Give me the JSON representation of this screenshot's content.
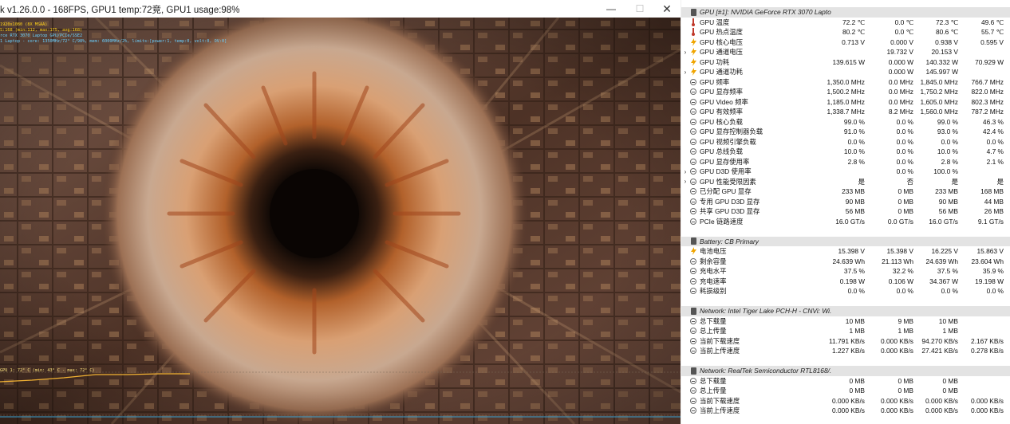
{
  "furmark": {
    "title": "k v1.26.0.0 - 168FPS, GPU1 temp:72竞, GPU1 usage:98%",
    "osd": [
      "1920x1080 (8X MSAA)",
      "S:168 (min:112, max:175, avg:168)",
      "rce RTX 3070 Laptop GPU/PCIe/SSE2",
      "1 Laptop - core: 1350MHz/72° C/98%, mem: 6000MHz/2%, limits:[power:1, temp:0, volt:0, OV:0]"
    ],
    "graph_label": "GPU 1: 72° C (min: 43° C - max: 72° C)",
    "controls": {
      "minimize": "—",
      "maximize": "☐",
      "close": "✕"
    },
    "colors": {
      "osd_yellow": "#ffd21a",
      "osd_blue": "#6ad0ff",
      "temp_line": "#f2b233"
    }
  },
  "hwinfo": {
    "rows": [
      {
        "type": "header",
        "label": "GPU [#1]: NVIDIA GeForce RTX 3070 Lapto..."
      },
      {
        "icon": "thermometer-icon",
        "label": "GPU 温度",
        "v": [
          "72.2 ℃",
          "0.0 ℃",
          "72.3 ℃",
          "49.6 ℃"
        ]
      },
      {
        "icon": "thermometer-icon",
        "label": "GPU 热点温度",
        "v": [
          "80.2 ℃",
          "0.0 ℃",
          "80.6 ℃",
          "55.7 ℃"
        ]
      },
      {
        "icon": "voltage-icon",
        "label": "GPU 核心电压",
        "v": [
          "0.713 V",
          "0.000 V",
          "0.938 V",
          "0.595 V"
        ]
      },
      {
        "icon": "voltage-icon",
        "expand": true,
        "label": "GPU 通道电压",
        "v": [
          "",
          "19.732 V",
          "20.153 V",
          ""
        ]
      },
      {
        "icon": "voltage-icon",
        "label": "GPU 功耗",
        "v": [
          "139.615 W",
          "0.000 W",
          "140.332 W",
          "70.929 W"
        ]
      },
      {
        "icon": "voltage-icon",
        "expand": true,
        "label": "GPU 通道功耗",
        "v": [
          "",
          "0.000 W",
          "145.997 W",
          ""
        ]
      },
      {
        "icon": "gauge-icon",
        "label": "GPU 频率",
        "v": [
          "1,350.0 MHz",
          "0.0 MHz",
          "1,845.0 MHz",
          "766.7 MHz"
        ]
      },
      {
        "icon": "gauge-icon",
        "label": "GPU 显存频率",
        "v": [
          "1,500.2 MHz",
          "0.0 MHz",
          "1,750.2 MHz",
          "822.0 MHz"
        ]
      },
      {
        "icon": "gauge-icon",
        "label": "GPU Video 频率",
        "v": [
          "1,185.0 MHz",
          "0.0 MHz",
          "1,605.0 MHz",
          "802.3 MHz"
        ]
      },
      {
        "icon": "gauge-icon",
        "label": "GPU 有效频率",
        "v": [
          "1,338.7 MHz",
          "8.2 MHz",
          "1,560.0 MHz",
          "787.2 MHz"
        ]
      },
      {
        "icon": "gauge-icon",
        "label": "GPU 核心负载",
        "v": [
          "99.0 %",
          "0.0 %",
          "99.0 %",
          "46.3 %"
        ]
      },
      {
        "icon": "gauge-icon",
        "label": "GPU 显存控制器负载",
        "v": [
          "91.0 %",
          "0.0 %",
          "93.0 %",
          "42.4 %"
        ]
      },
      {
        "icon": "gauge-icon",
        "label": "GPU 视频引擎负载",
        "v": [
          "0.0 %",
          "0.0 %",
          "0.0 %",
          "0.0 %"
        ]
      },
      {
        "icon": "gauge-icon",
        "label": "GPU 总线负载",
        "v": [
          "10.0 %",
          "0.0 %",
          "10.0 %",
          "4.7 %"
        ]
      },
      {
        "icon": "gauge-icon",
        "label": "GPU 显存使用率",
        "v": [
          "2.8 %",
          "0.0 %",
          "2.8 %",
          "2.1 %"
        ]
      },
      {
        "icon": "gauge-icon",
        "expand": true,
        "label": "GPU D3D 使用率",
        "v": [
          "",
          "0.0 %",
          "100.0 %",
          ""
        ]
      },
      {
        "icon": "gauge-icon",
        "expand": true,
        "label": "GPU 性能受限因素",
        "v": [
          "是",
          "否",
          "是",
          "是"
        ]
      },
      {
        "icon": "gauge-icon",
        "label": "已分配 GPU 显存",
        "v": [
          "233 MB",
          "0 MB",
          "233 MB",
          "168 MB"
        ]
      },
      {
        "icon": "gauge-icon",
        "label": "专用 GPU D3D 显存",
        "v": [
          "90 MB",
          "0 MB",
          "90 MB",
          "44 MB"
        ]
      },
      {
        "icon": "gauge-icon",
        "label": "共享 GPU D3D 显存",
        "v": [
          "56 MB",
          "0 MB",
          "56 MB",
          "26 MB"
        ]
      },
      {
        "icon": "gauge-icon",
        "label": "PCIe 链路速度",
        "v": [
          "16.0 GT/s",
          "0.0 GT/s",
          "16.0 GT/s",
          "9.1 GT/s"
        ]
      },
      {
        "type": "spacer"
      },
      {
        "type": "header",
        "label": "Battery: CB Primary"
      },
      {
        "icon": "voltage-icon",
        "label": "电池电压",
        "v": [
          "15.398 V",
          "15.398 V",
          "16.225 V",
          "15.863 V"
        ]
      },
      {
        "icon": "gauge-icon",
        "label": "剩余容量",
        "v": [
          "24.639 Wh",
          "21.113 Wh",
          "24.639 Wh",
          "23.604 Wh"
        ]
      },
      {
        "icon": "gauge-icon",
        "label": "充电水平",
        "v": [
          "37.5 %",
          "32.2 %",
          "37.5 %",
          "35.9 %"
        ]
      },
      {
        "icon": "gauge-icon",
        "label": "充电速率",
        "v": [
          "0.198 W",
          "0.106 W",
          "34.367 W",
          "19.198 W"
        ]
      },
      {
        "icon": "gauge-icon",
        "label": "耗损级别",
        "v": [
          "0.0 %",
          "0.0 %",
          "0.0 %",
          "0.0 %"
        ]
      },
      {
        "type": "spacer"
      },
      {
        "type": "header",
        "label": "Network: Intel Tiger Lake PCH-H - CNVi: Wi..."
      },
      {
        "icon": "gauge-icon",
        "label": "总下载量",
        "v": [
          "10 MB",
          "9 MB",
          "10 MB",
          ""
        ]
      },
      {
        "icon": "gauge-icon",
        "label": "总上传量",
        "v": [
          "1 MB",
          "1 MB",
          "1 MB",
          ""
        ]
      },
      {
        "icon": "gauge-icon",
        "label": "当前下载速度",
        "v": [
          "11.791 KB/s",
          "0.000 KB/s",
          "94.270 KB/s",
          "2.167 KB/s"
        ]
      },
      {
        "icon": "gauge-icon",
        "label": "当前上传速度",
        "v": [
          "1.227 KB/s",
          "0.000 KB/s",
          "27.421 KB/s",
          "0.278 KB/s"
        ]
      },
      {
        "type": "spacer"
      },
      {
        "type": "header",
        "label": "Network: RealTek Semiconductor RTL8168/..."
      },
      {
        "icon": "gauge-icon",
        "label": "总下载量",
        "v": [
          "0 MB",
          "0 MB",
          "0 MB",
          ""
        ]
      },
      {
        "icon": "gauge-icon",
        "label": "总上传量",
        "v": [
          "0 MB",
          "0 MB",
          "0 MB",
          ""
        ]
      },
      {
        "icon": "gauge-icon",
        "label": "当前下载速度",
        "v": [
          "0.000 KB/s",
          "0.000 KB/s",
          "0.000 KB/s",
          "0.000 KB/s"
        ]
      },
      {
        "icon": "gauge-icon",
        "label": "当前上传速度",
        "v": [
          "0.000 KB/s",
          "0.000 KB/s",
          "0.000 KB/s",
          "0.000 KB/s"
        ]
      }
    ]
  }
}
